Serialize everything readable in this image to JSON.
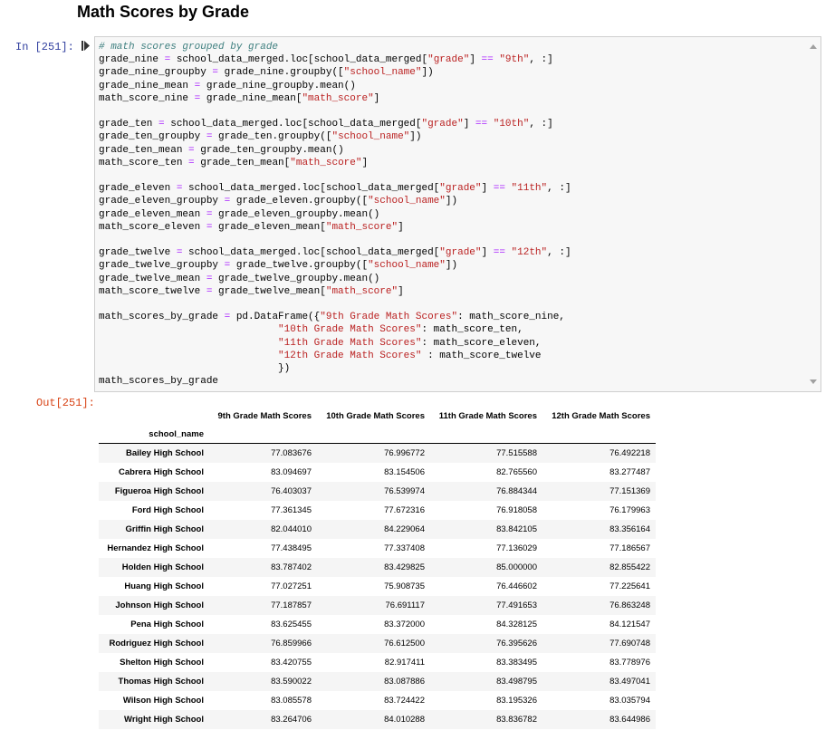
{
  "heading": "Math Scores by Grade",
  "input_prompt": "In [251]:",
  "output_prompt": "Out[251]:",
  "code_lines": [
    "# math scores grouped by grade",
    "grade_nine = school_data_merged.loc[school_data_merged[\"grade\"] == \"9th\", :]",
    "grade_nine_groupby = grade_nine.groupby([\"school_name\"])",
    "grade_nine_mean = grade_nine_groupby.mean()",
    "math_score_nine = grade_nine_mean[\"math_score\"]",
    "",
    "grade_ten = school_data_merged.loc[school_data_merged[\"grade\"] == \"10th\", :]",
    "grade_ten_groupby = grade_ten.groupby([\"school_name\"])",
    "grade_ten_mean = grade_ten_groupby.mean()",
    "math_score_ten = grade_ten_mean[\"math_score\"]",
    "",
    "grade_eleven = school_data_merged.loc[school_data_merged[\"grade\"] == \"11th\", :]",
    "grade_eleven_groupby = grade_eleven.groupby([\"school_name\"])",
    "grade_eleven_mean = grade_eleven_groupby.mean()",
    "math_score_eleven = grade_eleven_mean[\"math_score\"]",
    "",
    "grade_twelve = school_data_merged.loc[school_data_merged[\"grade\"] == \"12th\", :]",
    "grade_twelve_groupby = grade_twelve.groupby([\"school_name\"])",
    "grade_twelve_mean = grade_twelve_groupby.mean()",
    "math_score_twelve = grade_twelve_mean[\"math_score\"]",
    "",
    "math_scores_by_grade = pd.DataFrame({\"9th Grade Math Scores\": math_score_nine,",
    "                              \"10th Grade Math Scores\": math_score_ten,",
    "                              \"11th Grade Math Scores\": math_score_eleven,",
    "                              \"12th Grade Math Scores\" : math_score_twelve",
    "                              })",
    "math_scores_by_grade"
  ],
  "table": {
    "columns": [
      "9th Grade Math Scores",
      "10th Grade Math Scores",
      "11th Grade Math Scores",
      "12th Grade Math Scores"
    ],
    "index_name": "school_name",
    "rows": [
      {
        "school": "Bailey High School",
        "values": [
          "77.083676",
          "76.996772",
          "77.515588",
          "76.492218"
        ]
      },
      {
        "school": "Cabrera High School",
        "values": [
          "83.094697",
          "83.154506",
          "82.765560",
          "83.277487"
        ]
      },
      {
        "school": "Figueroa High School",
        "values": [
          "76.403037",
          "76.539974",
          "76.884344",
          "77.151369"
        ]
      },
      {
        "school": "Ford High School",
        "values": [
          "77.361345",
          "77.672316",
          "76.918058",
          "76.179963"
        ]
      },
      {
        "school": "Griffin High School",
        "values": [
          "82.044010",
          "84.229064",
          "83.842105",
          "83.356164"
        ]
      },
      {
        "school": "Hernandez High School",
        "values": [
          "77.438495",
          "77.337408",
          "77.136029",
          "77.186567"
        ]
      },
      {
        "school": "Holden High School",
        "values": [
          "83.787402",
          "83.429825",
          "85.000000",
          "82.855422"
        ]
      },
      {
        "school": "Huang High School",
        "values": [
          "77.027251",
          "75.908735",
          "76.446602",
          "77.225641"
        ]
      },
      {
        "school": "Johnson High School",
        "values": [
          "77.187857",
          "76.691117",
          "77.491653",
          "76.863248"
        ]
      },
      {
        "school": "Pena High School",
        "values": [
          "83.625455",
          "83.372000",
          "84.328125",
          "84.121547"
        ]
      },
      {
        "school": "Rodriguez High School",
        "values": [
          "76.859966",
          "76.612500",
          "76.395626",
          "77.690748"
        ]
      },
      {
        "school": "Shelton High School",
        "values": [
          "83.420755",
          "82.917411",
          "83.383495",
          "83.778976"
        ]
      },
      {
        "school": "Thomas High School",
        "values": [
          "83.590022",
          "83.087886",
          "83.498795",
          "83.497041"
        ]
      },
      {
        "school": "Wilson High School",
        "values": [
          "83.085578",
          "83.724422",
          "83.195326",
          "83.035794"
        ]
      },
      {
        "school": "Wright High School",
        "values": [
          "83.264706",
          "84.010288",
          "83.836782",
          "83.644986"
        ]
      }
    ]
  }
}
